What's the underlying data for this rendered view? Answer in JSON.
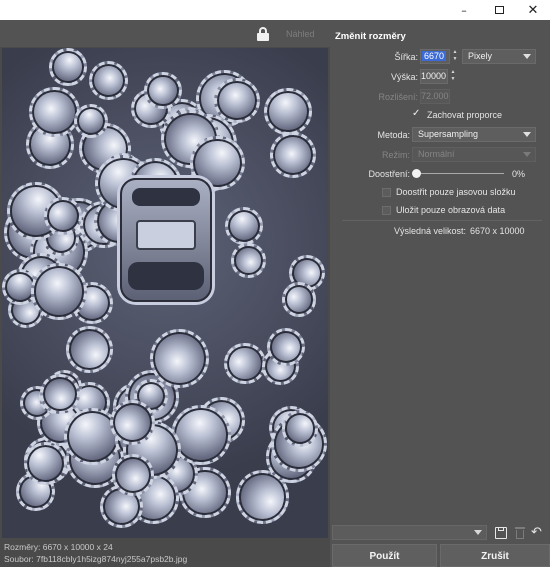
{
  "window": {
    "controls": {
      "minimize": "–",
      "close": "✕"
    }
  },
  "preview": {
    "lock_icon": "lock-icon",
    "toggle_label": "Náhled",
    "status_dimensions": "Rozměry: 6670 x 10000 x 24",
    "status_file": "Soubor: 7fb118cbly1h5izg874nyj255a7psb2b.jpg"
  },
  "panel": {
    "title": "Změnit rozměry",
    "width": {
      "label": "Šířka:",
      "value": "6670"
    },
    "unit": {
      "selected": "Pixely"
    },
    "height": {
      "label": "Výška:",
      "value": "10000"
    },
    "resolution": {
      "label": "Rozlišení:",
      "value": "72.000"
    },
    "keep_proportions": {
      "label": "Zachovat proporce",
      "checked": true
    },
    "method": {
      "label": "Metoda:",
      "selected": "Supersampling"
    },
    "mode": {
      "label": "Režim:",
      "selected": "Normální"
    },
    "sharpen": {
      "label": "Doostření:",
      "value": "0%",
      "level": 0
    },
    "sharpen_luma_only": {
      "label": "Doostřit pouze jasovou složku",
      "checked": false
    },
    "save_image_data_only": {
      "label": "Uložit pouze obrazová data",
      "checked": false
    },
    "result": {
      "label": "Výsledná velikost:",
      "value": "6670 x 10000"
    }
  },
  "footer": {
    "apply_label": "Použít",
    "cancel_label": "Zrušit",
    "icons": [
      "save-icon",
      "trash-icon",
      "undo-icon"
    ]
  },
  "colors": {
    "panel_bg": "#535353",
    "preview_bg": "#4a4a4a",
    "selection": "#3d6bd6"
  }
}
